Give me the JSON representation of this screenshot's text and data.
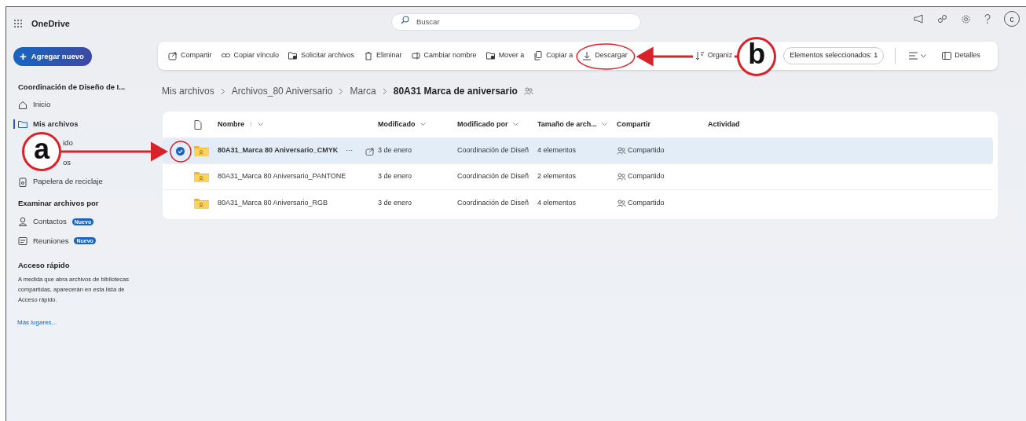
{
  "app": {
    "title": "OneDrive",
    "avatar": "c"
  },
  "search": {
    "placeholder": "Buscar"
  },
  "new_button": {
    "label": "Agregar nuevo",
    "icon": "+"
  },
  "toolbar": {
    "items": [
      {
        "label": "Compartir"
      },
      {
        "label": "Copiar vínculo"
      },
      {
        "label": "Solicitar archivos"
      },
      {
        "label": "Eliminar"
      },
      {
        "label": "Cambiar nombre"
      },
      {
        "label": "Mover a"
      },
      {
        "label": "Copiar a"
      },
      {
        "label": "Descargar"
      },
      {
        "label": "Organiz"
      }
    ],
    "selection": "Elementos seleccionados: 1",
    "details": "Detalles"
  },
  "sidebar": {
    "account": "Coordinación de Diseño de I...",
    "items": [
      {
        "label": "Inicio",
        "selected": false,
        "kind": "normal"
      },
      {
        "label": "Mis archivos",
        "selected": true,
        "kind": "normal"
      },
      {
        "label": "ido",
        "selected": false,
        "kind": "covered"
      },
      {
        "label": "os",
        "selected": false,
        "kind": "covered"
      },
      {
        "label": "Papelera de reciclaje",
        "selected": false,
        "kind": "normal"
      }
    ],
    "browse_heading": "Examinar archivos por",
    "browse": [
      {
        "label": "Contactos",
        "badge": "Nuevo"
      },
      {
        "label": "Reuniones",
        "badge": "Nuevo"
      }
    ],
    "quick_heading": "Acceso rápido",
    "quick_text": "A medida que abra archivos de bibliotecas compartidas, aparecerán en esta lista de Acceso rápido.",
    "more_link": "Más lugares..."
  },
  "breadcrumb": [
    "Mis archivos",
    "Archivos_80 Aniversario",
    "Marca",
    "80A31 Marca de aniversario"
  ],
  "table": {
    "columns": [
      {
        "label": "Nombre",
        "sort": "↑",
        "menu": true
      },
      {
        "label": "Modificado",
        "menu": true
      },
      {
        "label": "Modificado por",
        "menu": true
      },
      {
        "label": "Tamaño de arch...",
        "menu": true
      },
      {
        "label": "Compartir",
        "menu": false
      },
      {
        "label": "Actividad",
        "menu": false
      }
    ],
    "rows": [
      {
        "selected": true,
        "name": "80A31_Marca 80 Aniversario_CMYK",
        "actions": "···",
        "modified": "3 de enero",
        "modified_by": "Coordinación de Diseñ",
        "size": "4 elementos",
        "sharing": "Compartido"
      },
      {
        "selected": false,
        "name": "80A31_Marca 80 Aniversario_PANTONE",
        "modified": "3 de enero",
        "modified_by": "Coordinación de Diseñ",
        "size": "2 elementos",
        "sharing": "Compartido"
      },
      {
        "selected": false,
        "name": "80A31_Marca 80 Aniversario_RGB",
        "modified": "3 de enero",
        "modified_by": "Coordinación de Diseñ",
        "size": "4 elementos",
        "sharing": "Compartido"
      }
    ]
  },
  "annotations": [
    {
      "label": "a"
    },
    {
      "label": "b"
    }
  ]
}
